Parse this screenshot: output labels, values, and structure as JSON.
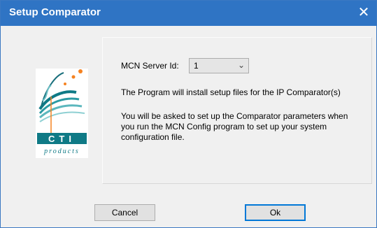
{
  "window": {
    "title": "Setup Comparator",
    "close_icon": "close-icon",
    "accent_color": "#2f74c4"
  },
  "logo": {
    "brand": "CTI",
    "sub": "products"
  },
  "form": {
    "server_label": "MCN Server Id:",
    "server_value": "1",
    "dropdown_icon": "chevron-down-icon",
    "info_line1": "The Program will install setup files for the IP Comparator(s)",
    "info_para": "You will be asked to set up the Comparator parameters when you run the MCN Config program to set up your system configuration file."
  },
  "buttons": {
    "cancel_label": "Cancel",
    "ok_label": "Ok"
  }
}
